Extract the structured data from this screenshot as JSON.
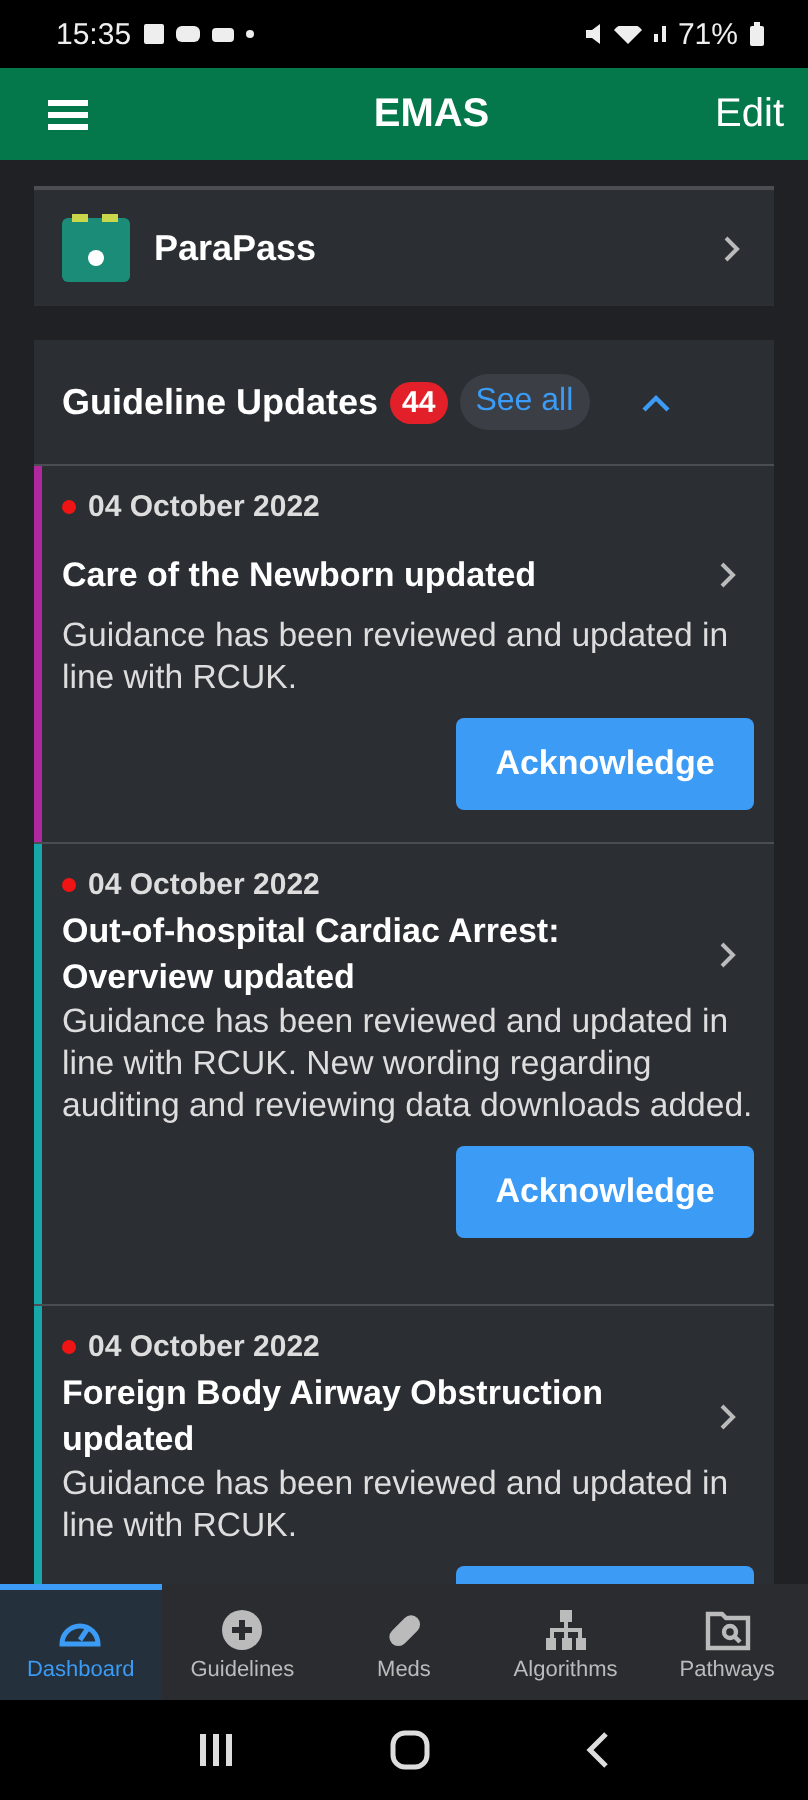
{
  "status_bar": {
    "time": "15:35",
    "battery": "71%"
  },
  "app_bar": {
    "title": "EMAS",
    "action": "Edit"
  },
  "shortcut": {
    "label": "ParaPass"
  },
  "updates": {
    "title": "Guideline Updates",
    "count": "44",
    "see_all": "See all",
    "expanded": true,
    "items": [
      {
        "date": "04 October 2022",
        "unread": true,
        "color": "#b0289e",
        "title": "Care of the Newborn updated",
        "body": "Guidance has been reviewed and updated in line with RCUK.",
        "action": "Acknowledge"
      },
      {
        "date": "04 October 2022",
        "unread": true,
        "color": "#17a7a8",
        "title": "Out-of-hospital Cardiac Arrest: Overview updated",
        "body": "Guidance has been reviewed and updated in line with RCUK. New wording regarding auditing and reviewing data downloads added.",
        "action": "Acknowledge"
      },
      {
        "date": "04 October 2022",
        "unread": true,
        "color": "#17a7a8",
        "title": "Foreign Body Airway Obstruction updated",
        "body": "Guidance has been reviewed and updated in line with RCUK."
      }
    ]
  },
  "tabs": [
    {
      "label": "Dashboard",
      "kind": "gauge",
      "selected": true
    },
    {
      "label": "Guidelines",
      "kind": "plus",
      "selected": false
    },
    {
      "label": "Meds",
      "kind": "pill",
      "selected": false
    },
    {
      "label": "Algorithms",
      "kind": "tree",
      "selected": false
    },
    {
      "label": "Pathways",
      "kind": "folder",
      "selected": false
    }
  ]
}
